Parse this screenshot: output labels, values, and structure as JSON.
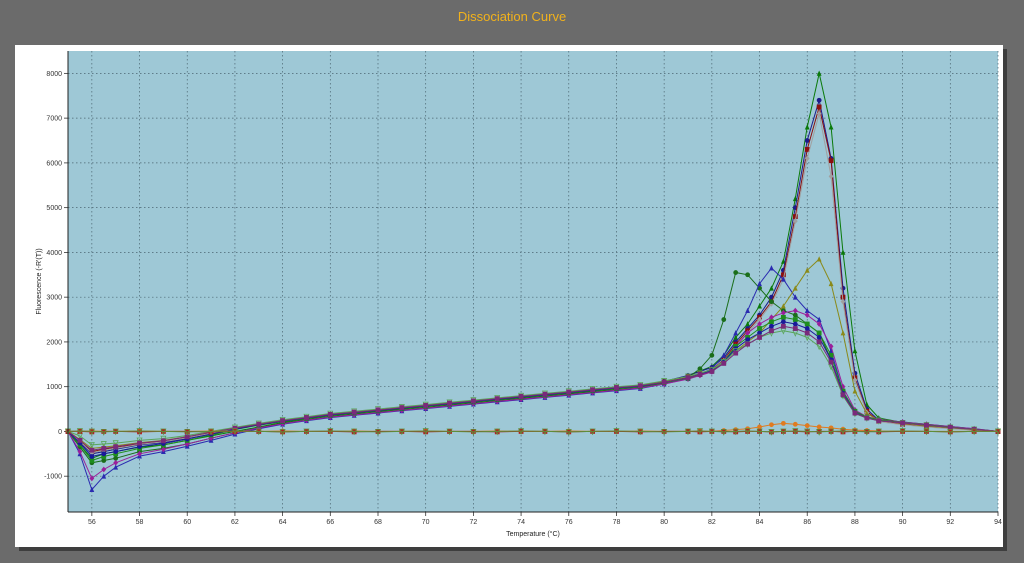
{
  "chart_data": {
    "type": "line",
    "title": "Dissociation Curve",
    "xlabel": "Temperature (°C)",
    "ylabel": "Fluorescence (-R'(T))",
    "xlim": [
      55,
      94
    ],
    "ylim": [
      -1800,
      8500
    ],
    "xticks": [
      56,
      58,
      60,
      62,
      64,
      66,
      68,
      70,
      72,
      74,
      76,
      78,
      80,
      82,
      84,
      86,
      88,
      90,
      92,
      94
    ],
    "yticks": [
      -1000,
      0,
      1000,
      2000,
      3000,
      4000,
      5000,
      6000,
      7000,
      8000
    ],
    "grid": true,
    "background_color": "#9ec8d6",
    "x": [
      55,
      55.5,
      56,
      56.5,
      57,
      58,
      59,
      60,
      61,
      62,
      63,
      64,
      65,
      66,
      67,
      68,
      69,
      70,
      71,
      72,
      73,
      74,
      75,
      76,
      77,
      78,
      79,
      80,
      81,
      81.5,
      82,
      82.5,
      83,
      83.5,
      84,
      84.5,
      85,
      85.5,
      86,
      86.5,
      87,
      87.5,
      88,
      88.5,
      89,
      90,
      91,
      92,
      93,
      94
    ],
    "series": [
      {
        "color": "#0a7a0a",
        "marker": "triangle",
        "values": [
          0,
          -300,
          -600,
          -500,
          -450,
          -350,
          -300,
          -200,
          -100,
          0,
          100,
          200,
          280,
          350,
          400,
          450,
          500,
          550,
          600,
          650,
          700,
          750,
          800,
          850,
          900,
          950,
          1000,
          1100,
          1250,
          1350,
          1450,
          1700,
          2100,
          2400,
          2800,
          3200,
          3800,
          5200,
          6800,
          8000,
          6800,
          4000,
          1800,
          600,
          300,
          200,
          150,
          100,
          50,
          0
        ]
      },
      {
        "color": "#1c1c8a",
        "marker": "circle",
        "values": [
          0,
          -250,
          -500,
          -450,
          -400,
          -300,
          -250,
          -150,
          -50,
          50,
          150,
          230,
          300,
          370,
          420,
          470,
          520,
          570,
          620,
          670,
          720,
          770,
          820,
          870,
          920,
          970,
          1020,
          1120,
          1250,
          1340,
          1430,
          1650,
          2000,
          2300,
          2600,
          3000,
          3600,
          5000,
          6500,
          7400,
          6100,
          3200,
          1300,
          500,
          250,
          180,
          120,
          80,
          40,
          0
        ]
      },
      {
        "color": "#8b1010",
        "marker": "square",
        "values": [
          0,
          -200,
          -450,
          -400,
          -350,
          -280,
          -220,
          -130,
          -30,
          60,
          160,
          240,
          310,
          380,
          430,
          480,
          530,
          580,
          630,
          680,
          730,
          780,
          830,
          880,
          930,
          980,
          1020,
          1110,
          1220,
          1300,
          1380,
          1600,
          1950,
          2250,
          2550,
          2900,
          3500,
          4800,
          6300,
          7250,
          6050,
          3000,
          1200,
          450,
          230,
          160,
          110,
          70,
          30,
          0
        ]
      },
      {
        "color": "#a0a0a0",
        "marker": "diamond",
        "values": [
          0,
          -220,
          -480,
          -420,
          -380,
          -290,
          -230,
          -140,
          -40,
          60,
          150,
          230,
          300,
          370,
          420,
          470,
          520,
          570,
          620,
          670,
          720,
          770,
          820,
          870,
          920,
          970,
          1010,
          1100,
          1210,
          1290,
          1370,
          1580,
          1900,
          2200,
          2500,
          2850,
          3400,
          4700,
          6100,
          7100,
          5700,
          2900,
          1150,
          420,
          220,
          150,
          100,
          60,
          30,
          0
        ]
      },
      {
        "color": "#1a6e1a",
        "marker": "circle",
        "values": [
          0,
          -350,
          -700,
          -650,
          -600,
          -450,
          -380,
          -280,
          -150,
          -30,
          80,
          180,
          260,
          330,
          380,
          430,
          480,
          530,
          580,
          630,
          680,
          730,
          780,
          830,
          880,
          930,
          980,
          1080,
          1200,
          1400,
          1700,
          2500,
          3550,
          3500,
          3200,
          2900,
          2700,
          2600,
          2400,
          2200,
          1600,
          800,
          400,
          300,
          250,
          200,
          150,
          100,
          50,
          0
        ]
      },
      {
        "color": "#2a2ab0",
        "marker": "triangle",
        "values": [
          0,
          -500,
          -1300,
          -1000,
          -800,
          -550,
          -450,
          -330,
          -200,
          -60,
          60,
          160,
          240,
          310,
          360,
          410,
          460,
          510,
          560,
          610,
          660,
          710,
          760,
          810,
          860,
          910,
          960,
          1060,
          1180,
          1280,
          1400,
          1700,
          2200,
          2700,
          3300,
          3650,
          3400,
          3000,
          2700,
          2500,
          1800,
          900,
          450,
          320,
          260,
          210,
          160,
          110,
          60,
          0
        ]
      },
      {
        "color": "#8a8a1a",
        "marker": "triangle",
        "values": [
          0,
          -180,
          -380,
          -350,
          -320,
          -250,
          -200,
          -120,
          -20,
          70,
          160,
          240,
          310,
          380,
          430,
          480,
          530,
          580,
          630,
          680,
          730,
          780,
          830,
          880,
          930,
          980,
          1020,
          1110,
          1220,
          1300,
          1380,
          1550,
          1800,
          2000,
          2200,
          2500,
          2800,
          3200,
          3600,
          3850,
          3300,
          2200,
          900,
          400,
          250,
          180,
          120,
          80,
          40,
          0
        ]
      },
      {
        "color": "#9b1f9b",
        "marker": "diamond",
        "values": [
          0,
          -450,
          -1050,
          -850,
          -700,
          -500,
          -400,
          -280,
          -150,
          -30,
          80,
          170,
          250,
          320,
          370,
          420,
          470,
          520,
          570,
          620,
          670,
          720,
          770,
          820,
          870,
          920,
          970,
          1060,
          1170,
          1250,
          1330,
          1550,
          1900,
          2200,
          2400,
          2550,
          2650,
          2700,
          2600,
          2400,
          1900,
          1000,
          480,
          330,
          270,
          210,
          160,
          110,
          60,
          0
        ]
      },
      {
        "color": "#1e8e1e",
        "marker": "square",
        "values": [
          0,
          -300,
          -650,
          -560,
          -500,
          -380,
          -300,
          -200,
          -80,
          40,
          140,
          220,
          290,
          360,
          410,
          460,
          510,
          560,
          610,
          660,
          710,
          760,
          810,
          860,
          910,
          960,
          1000,
          1090,
          1190,
          1270,
          1350,
          1560,
          1900,
          2100,
          2300,
          2450,
          2550,
          2500,
          2400,
          2200,
          1700,
          900,
          450,
          320,
          260,
          200,
          150,
          100,
          50,
          0
        ]
      },
      {
        "color": "#1a1a9a",
        "marker": "circle",
        "values": [
          0,
          -260,
          -560,
          -500,
          -450,
          -340,
          -270,
          -170,
          -60,
          50,
          150,
          230,
          300,
          370,
          420,
          470,
          520,
          570,
          620,
          670,
          720,
          770,
          820,
          870,
          920,
          970,
          1010,
          1100,
          1200,
          1280,
          1360,
          1560,
          1850,
          2050,
          2200,
          2350,
          2450,
          2400,
          2300,
          2100,
          1600,
          850,
          420,
          300,
          240,
          190,
          140,
          90,
          45,
          0
        ]
      },
      {
        "color": "#5aa55a",
        "marker": "triangle-down",
        "values": [
          0,
          -100,
          -300,
          -280,
          -260,
          -200,
          -160,
          -90,
          0,
          90,
          180,
          260,
          330,
          400,
          450,
          500,
          550,
          600,
          650,
          700,
          750,
          800,
          850,
          900,
          950,
          1000,
          1040,
          1130,
          1230,
          1300,
          1380,
          1550,
          1800,
          1950,
          2100,
          2200,
          2250,
          2200,
          2100,
          1900,
          1450,
          800,
          400,
          300,
          240,
          190,
          140,
          90,
          45,
          0
        ]
      },
      {
        "color": "#7a2a7a",
        "marker": "square",
        "values": [
          0,
          -200,
          -420,
          -380,
          -340,
          -260,
          -210,
          -120,
          -20,
          70,
          160,
          240,
          310,
          380,
          430,
          480,
          530,
          580,
          630,
          680,
          730,
          780,
          830,
          880,
          930,
          980,
          1020,
          1100,
          1200,
          1270,
          1340,
          1520,
          1750,
          1950,
          2100,
          2250,
          2350,
          2300,
          2200,
          2000,
          1550,
          820,
          410,
          300,
          240,
          190,
          140,
          90,
          45,
          0
        ]
      },
      {
        "color": "#e07b20",
        "marker": "circle",
        "values": [
          0,
          0,
          10,
          0,
          0,
          10,
          0,
          0,
          10,
          0,
          0,
          10,
          0,
          0,
          10,
          0,
          0,
          10,
          0,
          0,
          10,
          0,
          0,
          10,
          0,
          0,
          10,
          0,
          0,
          10,
          0,
          20,
          40,
          60,
          100,
          150,
          180,
          160,
          130,
          100,
          80,
          50,
          30,
          20,
          10,
          0,
          0,
          0,
          0,
          0
        ]
      },
      {
        "color": "#b02020",
        "marker": "square",
        "values": [
          0,
          0,
          -10,
          0,
          0,
          -10,
          0,
          0,
          -10,
          0,
          0,
          -10,
          0,
          0,
          -10,
          0,
          0,
          -10,
          0,
          0,
          -10,
          0,
          0,
          -10,
          0,
          0,
          -10,
          0,
          0,
          -10,
          0,
          0,
          -10,
          0,
          0,
          -10,
          0,
          0,
          -10,
          0,
          0,
          -10,
          0,
          0,
          -10,
          0,
          0,
          -10,
          0,
          0
        ]
      },
      {
        "color": "#5e8f3a",
        "marker": "triangle-down",
        "values": [
          0,
          10,
          0,
          -10,
          0,
          10,
          0,
          -10,
          0,
          10,
          0,
          -10,
          0,
          10,
          0,
          -10,
          0,
          10,
          0,
          -10,
          0,
          10,
          0,
          -10,
          0,
          10,
          0,
          -10,
          0,
          10,
          0,
          -10,
          0,
          10,
          0,
          -10,
          0,
          10,
          0,
          -10,
          0,
          10,
          0,
          -10,
          0,
          10,
          0,
          -10,
          0,
          0
        ]
      }
    ]
  }
}
